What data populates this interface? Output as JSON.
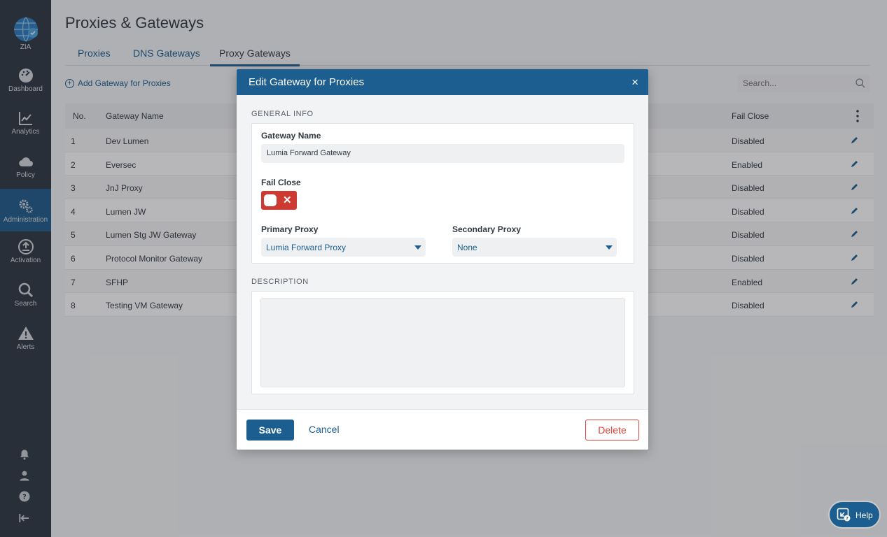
{
  "sidebar": {
    "items": [
      {
        "label": "ZIA",
        "icon": "globe-icon"
      },
      {
        "label": "Dashboard",
        "icon": "dashboard-icon"
      },
      {
        "label": "Analytics",
        "icon": "chart-line-icon"
      },
      {
        "label": "Policy",
        "icon": "cloud-icon"
      },
      {
        "label": "Administration",
        "icon": "gears-icon",
        "active": true
      },
      {
        "label": "Activation",
        "icon": "activation-icon"
      },
      {
        "label": "Search",
        "icon": "search-icon"
      },
      {
        "label": "Alerts",
        "icon": "warning-icon"
      }
    ]
  },
  "page": {
    "title": "Proxies & Gateways",
    "tabs": [
      {
        "label": "Proxies"
      },
      {
        "label": "DNS Gateways"
      },
      {
        "label": "Proxy Gateways",
        "active": true
      }
    ],
    "add_link": "Add Gateway for Proxies",
    "search_placeholder": "Search..."
  },
  "table": {
    "headers": {
      "no": "No.",
      "name": "Gateway Name",
      "fail_close": "Fail Close"
    },
    "rows": [
      {
        "no": "1",
        "name": "Dev Lumen",
        "fail_close": "Disabled"
      },
      {
        "no": "2",
        "name": "Eversec",
        "fail_close": "Enabled"
      },
      {
        "no": "3",
        "name": "JnJ Proxy",
        "fail_close": "Disabled"
      },
      {
        "no": "4",
        "name": "Lumen JW",
        "fail_close": "Disabled"
      },
      {
        "no": "5",
        "name": "Lumen Stg JW Gateway",
        "fail_close": "Disabled"
      },
      {
        "no": "6",
        "name": "Protocol Monitor Gateway",
        "fail_close": "Disabled"
      },
      {
        "no": "7",
        "name": "SFHP",
        "fail_close": "Enabled"
      },
      {
        "no": "8",
        "name": "Testing VM Gateway",
        "fail_close": "Disabled"
      }
    ]
  },
  "modal": {
    "title": "Edit Gateway for Proxies",
    "close": "×",
    "general_info": "GENERAL INFO",
    "gateway_name_label": "Gateway Name",
    "gateway_name_value": "Lumia Forward Gateway",
    "fail_close_label": "Fail Close",
    "fail_close_on": false,
    "primary_proxy_label": "Primary Proxy",
    "primary_proxy_value": "Lumia Forward Proxy",
    "secondary_proxy_label": "Secondary Proxy",
    "secondary_proxy_value": "None",
    "description_label": "DESCRIPTION",
    "description_value": "",
    "save": "Save",
    "cancel": "Cancel",
    "delete": "Delete"
  },
  "help": {
    "label": "Help"
  },
  "colors": {
    "accent": "#1c5e8f",
    "danger": "#d9443a",
    "sidebar": "#2f3742"
  }
}
